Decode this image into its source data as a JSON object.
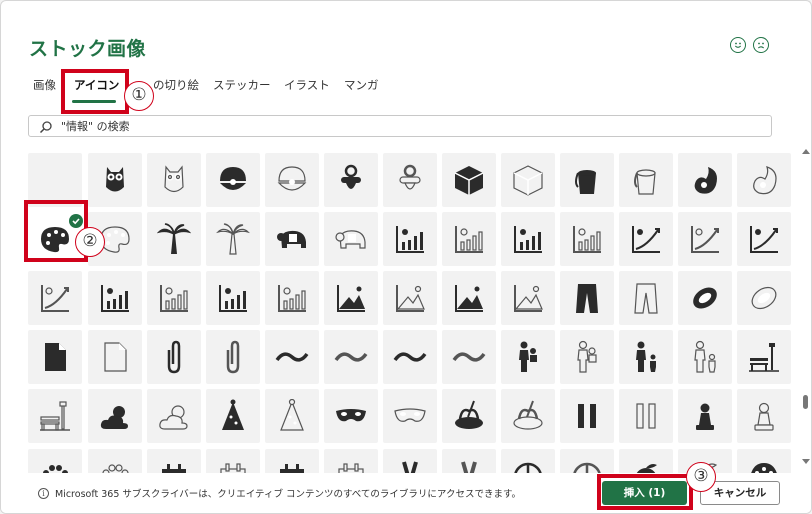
{
  "dialog": {
    "title": "ストック画像",
    "feedback": {
      "smile_icon": "smile-face-icon",
      "frown_icon": "frown-face-icon"
    }
  },
  "tabs": [
    {
      "label": "画像",
      "active": false
    },
    {
      "label": "アイコン",
      "active": true
    },
    {
      "label": "の切り絵",
      "active": false
    },
    {
      "label": "ステッカー",
      "active": false
    },
    {
      "label": "イラスト",
      "active": false
    },
    {
      "label": "マンガ",
      "active": false
    }
  ],
  "search": {
    "value": "",
    "placeholder": "\"情報\" の検索"
  },
  "icons": [
    [
      "park-night-icon",
      "owl-filled-icon",
      "owl-outline-icon",
      "clam-pearl-filled-icon",
      "clam-pearl-outline-icon",
      "pacifier-filled-icon",
      "pacifier-outline-icon",
      "box-filled-icon",
      "box-outline-icon",
      "paint-bucket-filled-icon",
      "paint-bucket-outline-icon",
      "paisley-filled-icon",
      "paisley-outline-icon"
    ],
    [
      "palette-filled-icon",
      "palette-outline-icon",
      "palm-tree-filled-icon",
      "palm-tree-outline-icon",
      "panda-filled-icon",
      "panda-outline-icon",
      "sun-bar-chart-filled-icon",
      "sun-bar-chart-outline-icon",
      "sun-bar-chart-filled-icon",
      "sun-bar-chart-outline-icon",
      "growth-chart-filled-icon",
      "growth-chart-outline-icon",
      "growth-chart-filled-icon"
    ],
    [
      "growth-chart-outline-icon",
      "sun-bar-chart-filled-icon",
      "sun-bar-chart-outline-icon",
      "sun-bar-chart-filled-icon",
      "sun-bar-chart-outline-icon",
      "mountain-chart-filled-icon",
      "mountain-chart-outline-icon",
      "mountain-chart-filled-icon",
      "mountain-chart-outline-icon",
      "pants-filled-icon",
      "pants-outline-icon",
      "papaya-filled-icon",
      "papaya-outline-icon"
    ],
    [
      "paper-filled-icon",
      "paper-outline-icon",
      "paperclip-filled-icon",
      "paperclip-outline-icon",
      "wave-filled-icon",
      "wave-outline-icon",
      "wave-filled-icon",
      "wave-outline-icon",
      "parent-child-filled-icon",
      "parent-child-outline-icon",
      "parent-walk-filled-icon",
      "parent-walk-outline-icon",
      "park-bench-filled-icon"
    ],
    [
      "park-bench-outline-icon",
      "sun-cloud-filled-icon",
      "sun-cloud-outline-icon",
      "party-hat-filled-icon",
      "party-hat-outline-icon",
      "party-mask-filled-icon",
      "party-mask-outline-icon",
      "pasta-filled-icon",
      "pasta-outline-icon",
      "pause-filled-icon",
      "pause-outline-icon",
      "pawn-filled-icon",
      "pawn-outline-icon"
    ],
    [
      "paw-print-filled-icon",
      "paw-print-outline-icon",
      "calendar-filled-icon",
      "calendar-outline-icon",
      "calendar-filled-icon",
      "calendar-outline-icon",
      "peace-sign-filled-icon",
      "peace-sign-outline-icon",
      "peace-symbol-filled-icon",
      "peace-symbol-outline-icon",
      "peach-filled-icon",
      "peach-outline-icon",
      "peacock-filled-icon"
    ]
  ],
  "selected_icon_check": "checkmark-icon",
  "footer": {
    "info_text": "Microsoft 365 サブスクライバーは、クリエイティブ コンテンツのすべてのライブラリにアクセスできます。",
    "insert_label": "挿入 (1)",
    "cancel_label": "キャンセル"
  },
  "callouts": [
    "①",
    "②",
    "③"
  ],
  "colors": {
    "accent": "#217346",
    "highlight": "#d0021b",
    "tile": "#f2f2f2"
  }
}
